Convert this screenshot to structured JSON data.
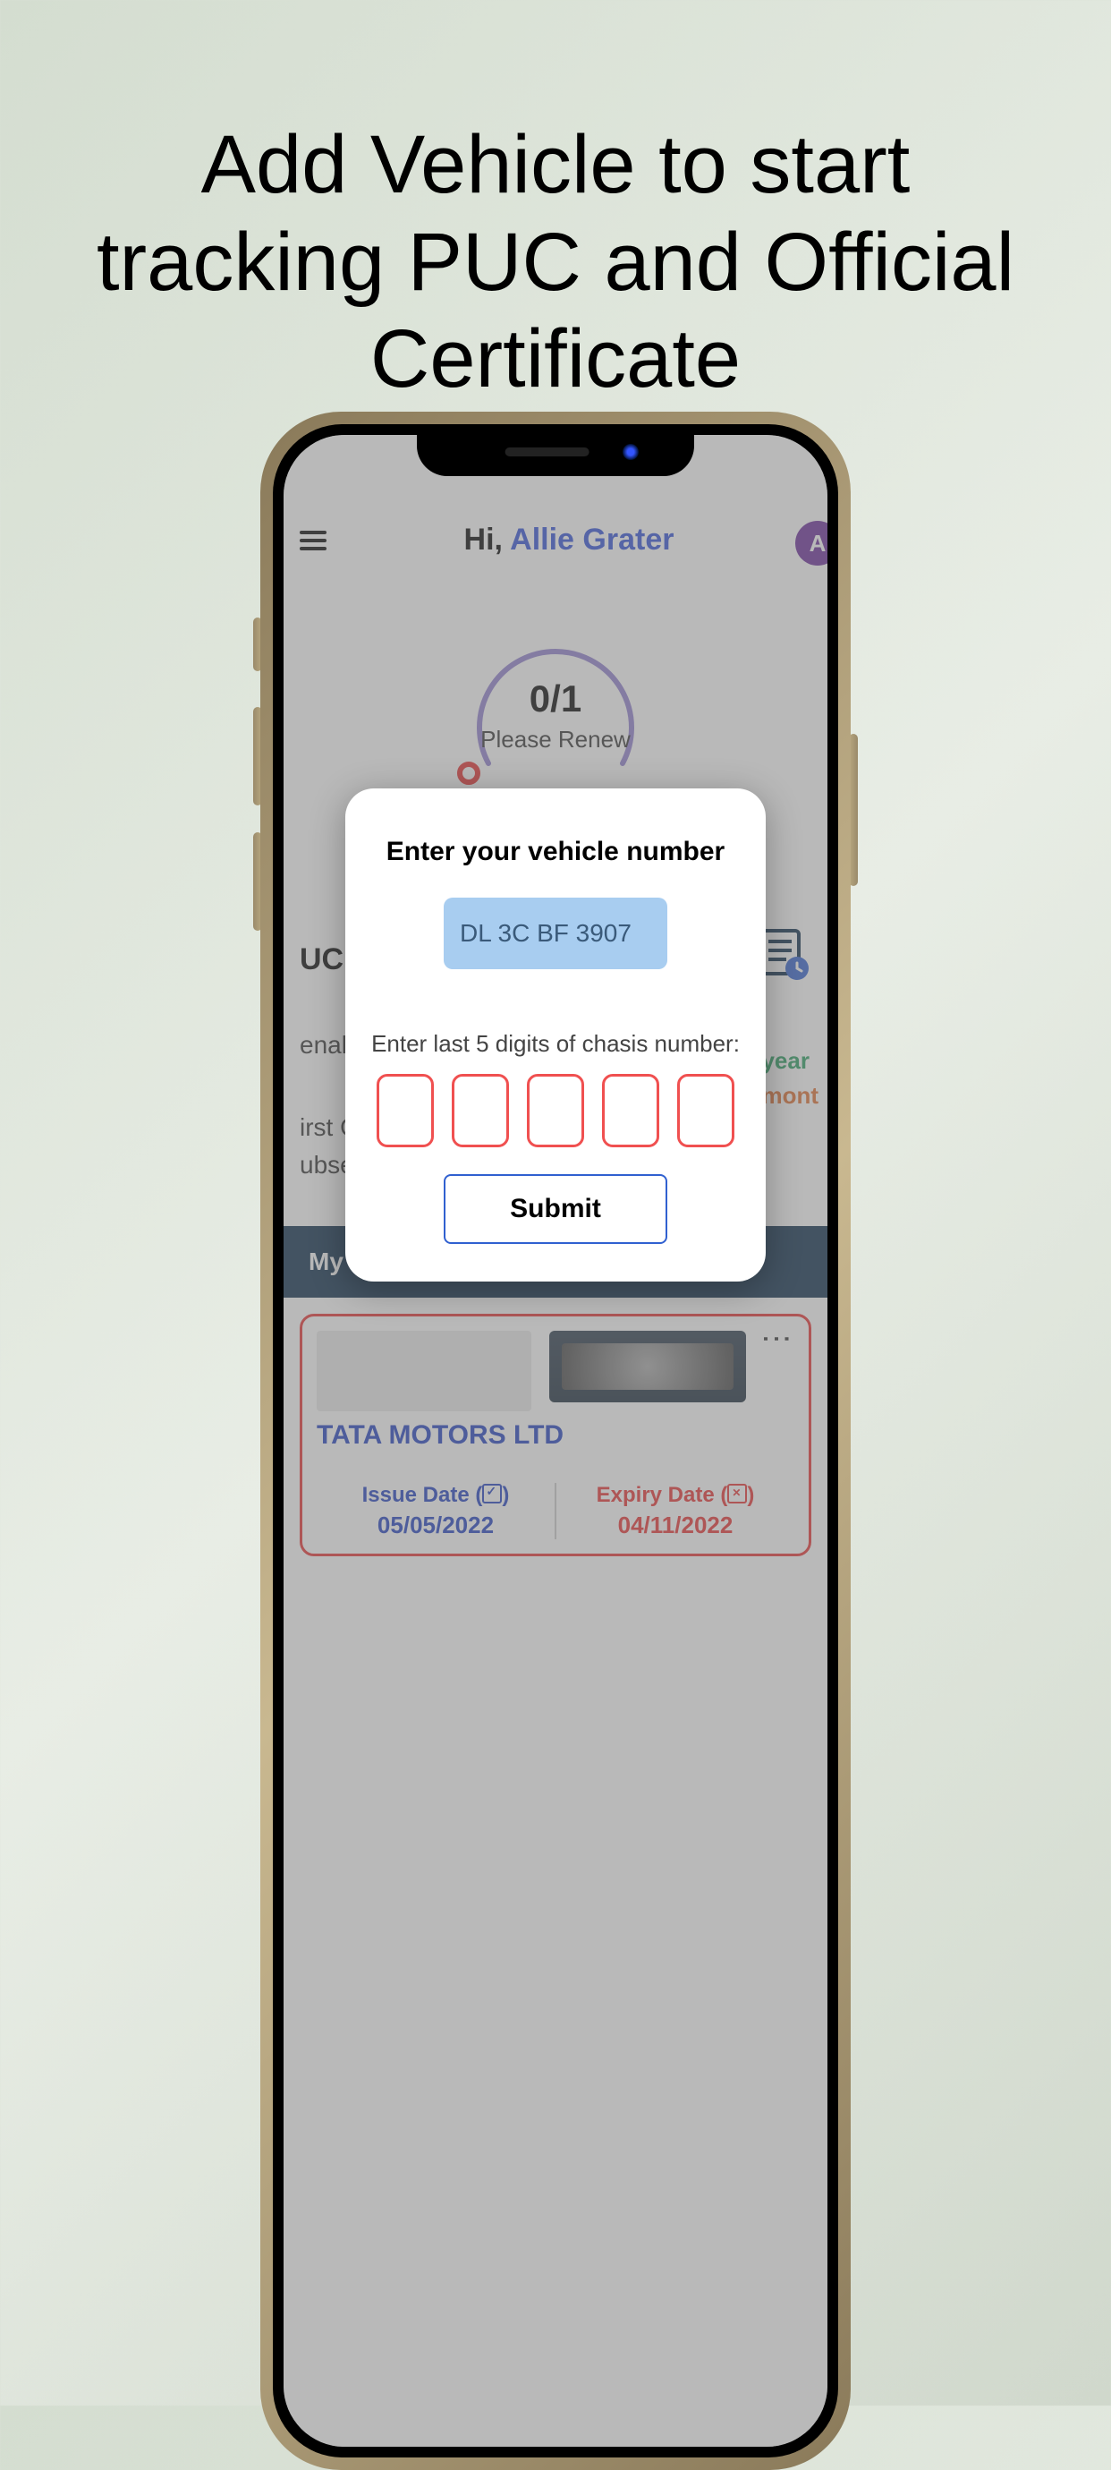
{
  "promo": {
    "title": "Add Vehicle to start tracking PUC and Official Certificate"
  },
  "header": {
    "greeting_prefix": "Hi, ",
    "user_name": "Allie Grater",
    "avatar_initial": "A"
  },
  "gauge": {
    "ratio": "0/1",
    "label": "Please Renew"
  },
  "info": {
    "section_title_partial": "UC P",
    "penalty_label_partial": "enal",
    "first_offence_partial": "irst O",
    "subsequent_partial": "ubse",
    "free_year": "year",
    "free_month": "mont"
  },
  "vehicles": {
    "heading_partial": "My ",
    "card": {
      "maker": "TATA MOTORS LTD",
      "issue_label": "Issue Date (",
      "issue_label_close": ")",
      "issue_date": "05/05/2022",
      "expiry_label": "Expiry Date (",
      "expiry_label_close": ")",
      "expiry_date": "04/11/2022"
    }
  },
  "modal": {
    "title": "Enter your vehicle number",
    "vehicle_placeholder": "DL 3C BF 3907",
    "chassis_label": "Enter last 5 digits of chasis number:",
    "submit_label": "Submit"
  }
}
